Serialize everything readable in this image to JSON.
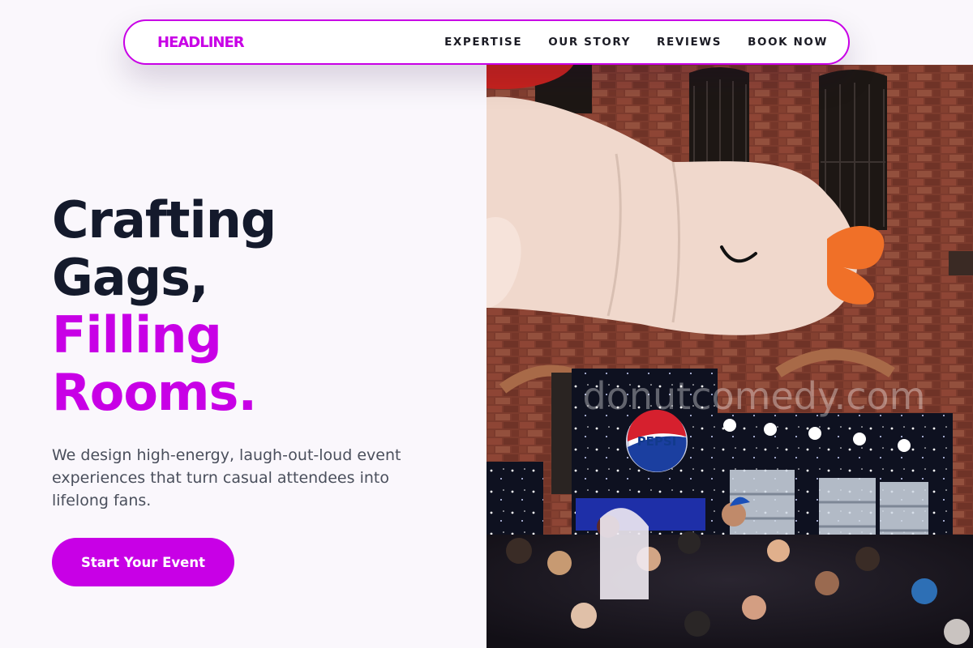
{
  "nav": {
    "brand": "HEADLINER",
    "links": [
      {
        "label": "EXPERTISE"
      },
      {
        "label": "OUR STORY"
      },
      {
        "label": "REVIEWS"
      },
      {
        "label": "BOOK NOW"
      }
    ]
  },
  "hero": {
    "title_line1": "Crafting",
    "title_line2": "Gags,",
    "title_line3": "Filling",
    "title_line4": "Rooms.",
    "subtitle": "We design high-energy, laugh-out-loud event experiences that turn casual attendees into lifelong fans.",
    "cta_label": "Start Your Event",
    "image": {
      "brand_text": "PEPSI",
      "watermark": "donutcomedy.com"
    }
  },
  "colors": {
    "accent": "#c800e6",
    "heading": "#141a2c",
    "body_text": "#4a4f5c",
    "background": "#faf7fc"
  }
}
